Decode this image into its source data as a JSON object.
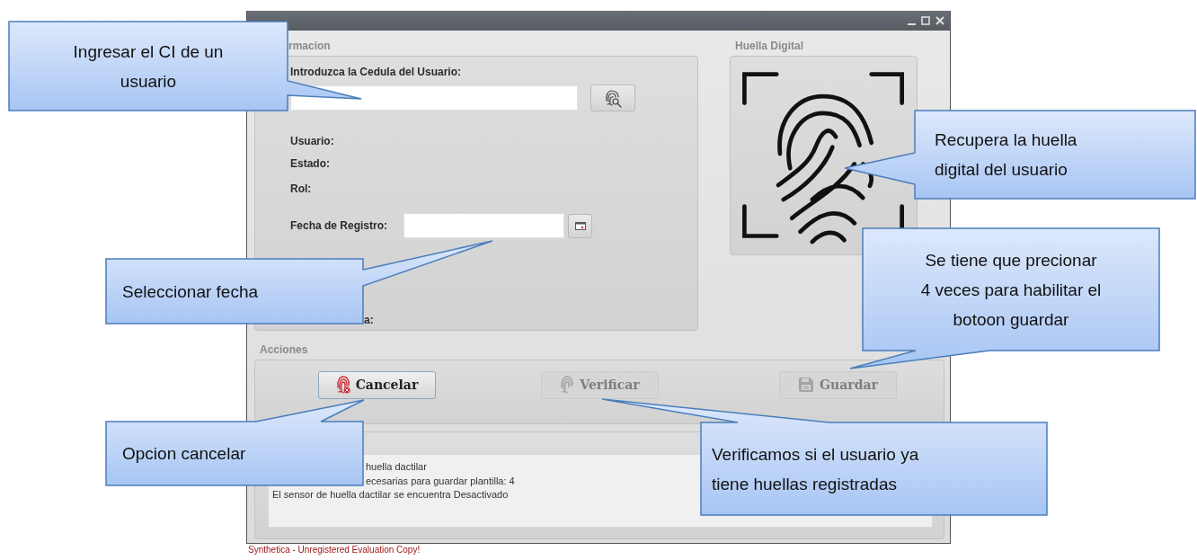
{
  "info_group": {
    "title": "rmacion",
    "cedula_label": "Introduzca la Cedula del Usuario:",
    "fields": [
      {
        "label": "Usuario:"
      },
      {
        "label": "Estado:"
      },
      {
        "label": "Rol:"
      }
    ],
    "date_label": "Fecha de Registro:",
    "partial_label": "a:"
  },
  "fingerprint_group": {
    "title": "Huella Digital"
  },
  "actions_group": {
    "title": "Acciones",
    "buttons": [
      {
        "label": "Cancelar",
        "disabled": false
      },
      {
        "label": "Verificar",
        "disabled": true
      },
      {
        "label": "Guardar",
        "disabled": true
      }
    ]
  },
  "log": {
    "lines": [
      "huella dactilar",
      "ecesarias para guardar plantilla: 4",
      "El sensor de huella dactilar se encuentra Desactivado"
    ]
  },
  "footer": "Synthetica - Unregistered Evaluation Copy!",
  "callouts": [
    {
      "text": "Ingresar el CI de un\nusuario"
    },
    {
      "text": "Seleccionar fecha"
    },
    {
      "text": "Recupera la huella\ndigital del usuario"
    },
    {
      "text": "Se tiene que precionar\n4 veces para habilitar el\nbotoon guardar"
    },
    {
      "text": "Opcion cancelar"
    },
    {
      "text": "Verificamos si el usuario ya\ntiene huellas registradas"
    }
  ]
}
